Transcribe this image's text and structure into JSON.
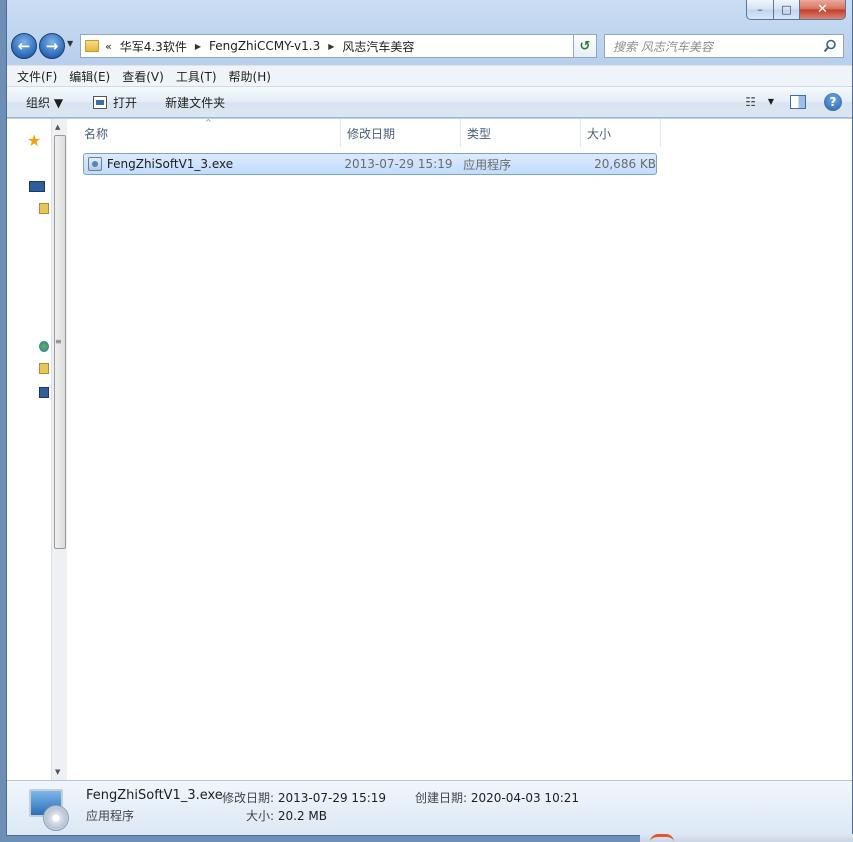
{
  "window": {
    "caption_buttons": {
      "minimize": "–",
      "maximize": "□",
      "close": "✕"
    }
  },
  "nav": {
    "back_glyph": "←",
    "forward_glyph": "→",
    "dropdown_glyph": "▼",
    "breadcrumb_lead": "«",
    "breadcrumbs": [
      "华军4.3软件",
      "FengZhiCCMY-v1.3",
      "风志汽车美容"
    ],
    "separator_glyph": "▶",
    "refresh_glyph": "↺",
    "search_placeholder": "搜索 风志汽车美容"
  },
  "menu": {
    "items": [
      "文件(F)",
      "编辑(E)",
      "查看(V)",
      "工具(T)",
      "帮助(H)"
    ]
  },
  "commands": {
    "organize": "组织 ▼",
    "open": "打开",
    "new_folder": "新建文件夹",
    "view_glyph": "☷",
    "help_glyph": "?"
  },
  "nav_pane": {
    "favorites_glyph": "★",
    "scroll_grip": "≡",
    "scroll_up": "▲",
    "scroll_down": "▼"
  },
  "columns": {
    "name": "名称",
    "date": "修改日期",
    "type": "类型",
    "size": "大小",
    "sort_glyph": "^"
  },
  "files": [
    {
      "name": "FengZhiSoftV1_3.exe",
      "date": "2013-07-29 15:19",
      "type": "应用程序",
      "size": "20,686 KB"
    }
  ],
  "details": {
    "filename": "FengZhiSoftV1_3.exe",
    "type": "应用程序",
    "modified_label": "修改日期:",
    "modified_value": "2013-07-29 15:19",
    "size_label": "大小:",
    "size_value": "20.2 MB",
    "created_label": "创建日期:",
    "created_value": "2020-04-03 10:21"
  }
}
